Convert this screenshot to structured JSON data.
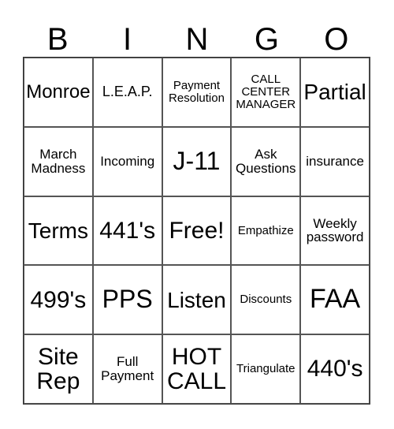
{
  "header": [
    "B",
    "I",
    "N",
    "G",
    "O"
  ],
  "cells": [
    [
      "Monroe",
      "L.E.A.P.",
      "Payment\nResolution",
      "CALL\nCENTER\nMANAGER",
      "Partial"
    ],
    [
      "March\nMadness",
      "Incoming",
      "J-11",
      "Ask\nQuestions",
      "insurance"
    ],
    [
      "Terms",
      "441's",
      "Free!",
      "Empathize",
      "Weekly\npassword"
    ],
    [
      "499's",
      "PPS",
      "Listen",
      "Discounts",
      "FAA"
    ],
    [
      "Site\nRep",
      "Full\nPayment",
      "HOT\nCALL",
      "Triangulate",
      "440's"
    ]
  ]
}
